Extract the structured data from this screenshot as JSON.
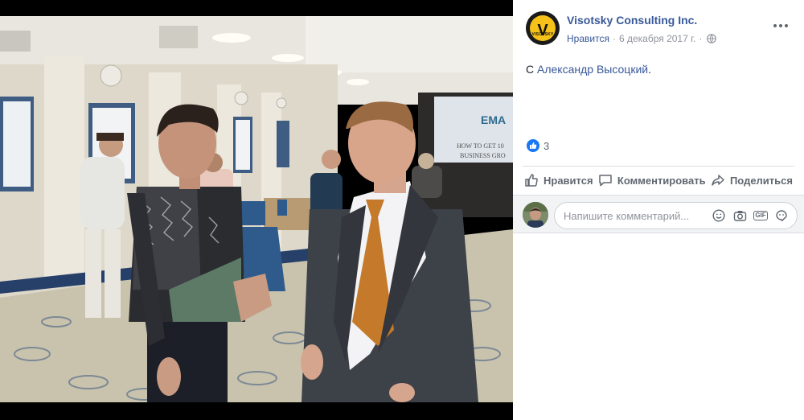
{
  "post": {
    "page_name": "Visotsky Consulting Inc.",
    "avatar_brand": "VISOTSKY",
    "avatar_letter": "V",
    "meta_like": "Нравится",
    "meta_sep": "·",
    "date": "6 декабря 2017 г.",
    "meta_sep2": "·",
    "caption_prefix": "С",
    "caption_tag": "Александр Высоцкий",
    "caption_suffix": ".",
    "reaction_count": "3"
  },
  "actions": {
    "like": "Нравится",
    "comment": "Комментировать",
    "share": "Поделиться"
  },
  "comment": {
    "placeholder": "Напишите комментарий..."
  },
  "photo": {
    "screen_text_1": "EMA",
    "screen_text_2": "HOW TO GET 10",
    "screen_text_3": "BUSINESS GRO"
  },
  "colors": {
    "link": "#385898",
    "accent": "#1877f2",
    "brand_yellow": "#f6c21a"
  },
  "icons": [
    "globe-icon",
    "more-icon",
    "like-reaction-icon",
    "thumb-up-icon",
    "comment-icon",
    "share-icon",
    "emoji-icon",
    "camera-icon",
    "gif-icon",
    "sticker-icon"
  ]
}
